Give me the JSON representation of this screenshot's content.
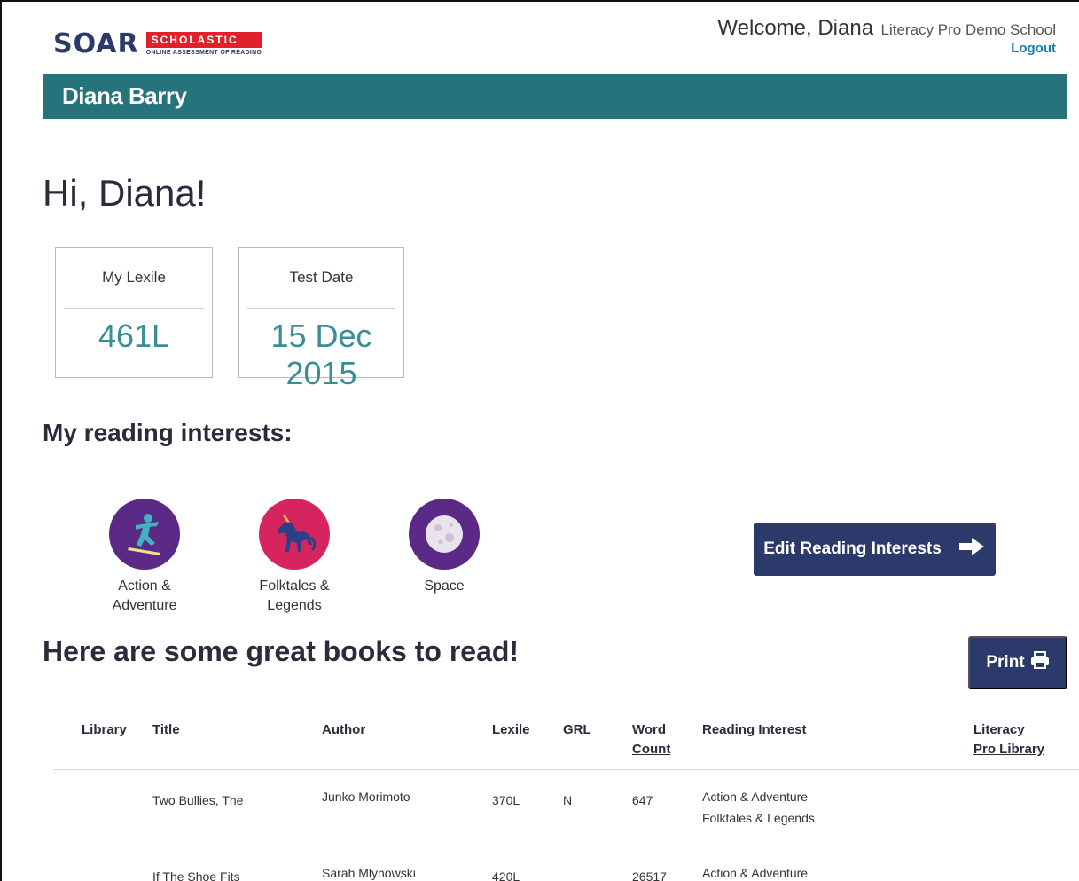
{
  "header": {
    "logo_text": "SOAR",
    "logo_brand": "SCHOLASTIC",
    "logo_tagline": "ONLINE ASSESSMENT OF READING",
    "welcome": "Welcome, Diana",
    "school": "Literacy Pro Demo School",
    "logout": "Logout"
  },
  "banner": {
    "student_name": "Diana Barry"
  },
  "greeting": "Hi, Diana!",
  "stats": {
    "lexile_label": "My Lexile",
    "lexile_value": "461L",
    "date_label": "Test Date",
    "date_value": "15 Dec 2015"
  },
  "interests": {
    "title": "My reading interests:",
    "items": [
      {
        "label_line1": "Action &",
        "label_line2": "Adventure",
        "icon": "snowboarder-icon",
        "color": "#5b2a86"
      },
      {
        "label_line1": "Folktales &",
        "label_line2": "Legends",
        "icon": "unicorn-icon",
        "color": "#d6245f"
      },
      {
        "label_line1": "Space",
        "label_line2": "",
        "icon": "moon-icon",
        "color": "#5b2a86"
      }
    ],
    "edit_button": "Edit Reading Interests"
  },
  "books": {
    "title": "Here are some great books to read!",
    "print_button": "Print",
    "columns": {
      "library": "Library",
      "title": "Title",
      "author": "Author",
      "lexile": "Lexile",
      "grl": "GRL",
      "word_count_1": "Word",
      "word_count_2": "Count",
      "reading_interest": "Reading Interest",
      "lp_library_1": "Literacy",
      "lp_library_2": "Pro Library"
    },
    "rows": [
      {
        "library": "",
        "title": "Two Bullies, The",
        "author": "Junko Morimoto",
        "lexile": "370L",
        "grl": "N",
        "word_count": "647",
        "interest_1": "Action & Adventure",
        "interest_2": "Folktales & Legends",
        "lp_library": ""
      },
      {
        "library": "",
        "title": "If The Shoe Fits",
        "author": "Sarah Mlynowski",
        "lexile": "420L",
        "grl": "",
        "word_count": "26517",
        "interest_1": "Action & Adventure",
        "interest_2": "",
        "lp_library": ""
      }
    ]
  },
  "colors": {
    "banner": "#26737b",
    "primary_button": "#2c3a6b",
    "lexile_value": "#3a8c95",
    "logout_link": "#1f7aa8",
    "brand_red": "#e2202a"
  }
}
